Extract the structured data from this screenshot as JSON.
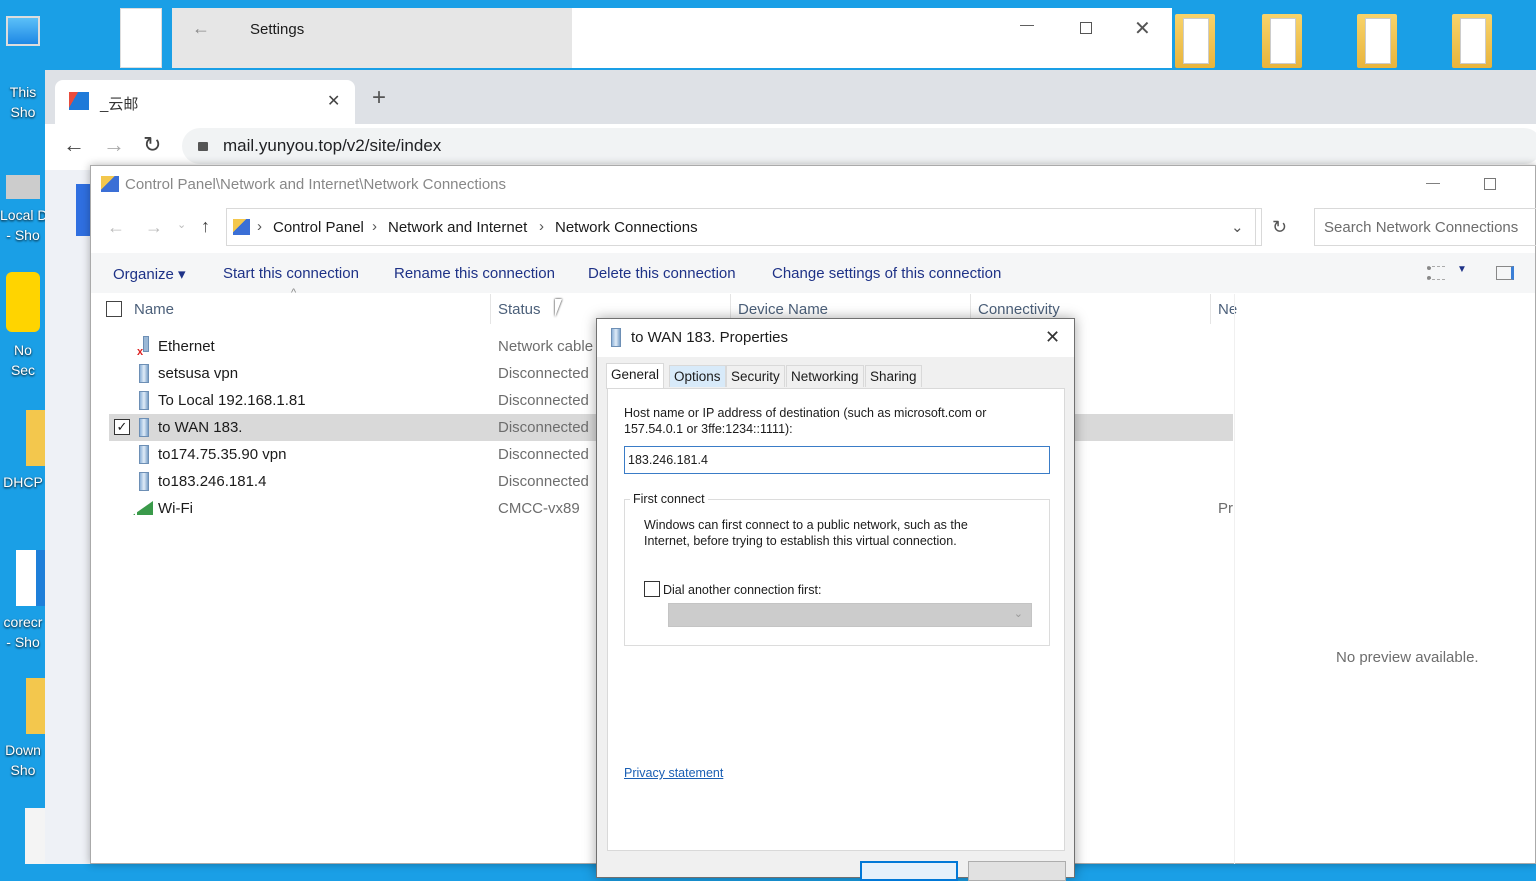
{
  "desktop": {
    "icons": [
      {
        "label": "This PC - Shortcut",
        "short1": "This",
        "short2": "Sho"
      },
      {
        "label": "Local Disk - Shortcut",
        "short1": "Local D",
        "short2": "- Sho"
      },
      {
        "label": "Norton Security",
        "short1": "No",
        "short2": "Sec"
      },
      {
        "label": "DHCP",
        "short1": "DHCP",
        "short2": ""
      },
      {
        "label": "corecr - Shortcut",
        "short1": "corecr",
        "short2": "- Sho"
      },
      {
        "label": "Downloads - Shortcut",
        "short1": "Down",
        "short2": "Sho"
      }
    ]
  },
  "settings": {
    "title": "Settings"
  },
  "chrome": {
    "tab_title": "_云邮",
    "url": "mail.yunyou.top/v2/site/index"
  },
  "explorer": {
    "title": "Control Panel\\Network and Internet\\Network Connections",
    "breadcrumb": [
      "Control Panel",
      "Network and Internet",
      "Network Connections"
    ],
    "search_placeholder": "Search Network Connections",
    "commands": [
      "Organize",
      "Start this connection",
      "Rename this connection",
      "Delete this connection",
      "Change settings of this connection"
    ],
    "columns": [
      "Name",
      "Status",
      "Device Name",
      "Connectivity",
      "Ne"
    ],
    "rows": [
      {
        "name": "Ethernet",
        "status": "Network cable unplugged",
        "icon": "ethernet-disconnected-icon"
      },
      {
        "name": "setsusa vpn",
        "status": "Disconnected",
        "icon": "vpn-icon"
      },
      {
        "name": "To Local 192.168.1.81",
        "status": "Disconnected",
        "icon": "vpn-icon"
      },
      {
        "name": "to WAN 183.",
        "status": "Disconnected",
        "icon": "vpn-icon",
        "selected": true
      },
      {
        "name": "to174.75.35.90 vpn",
        "status": "Disconnected",
        "icon": "vpn-icon"
      },
      {
        "name": "to183.246.181.4",
        "status": "Disconnected",
        "icon": "vpn-icon"
      },
      {
        "name": "Wi-Fi",
        "status": "CMCC-vx89",
        "icon": "wifi-icon",
        "extra": "Pri"
      }
    ],
    "preview_text": "No preview available."
  },
  "dialog": {
    "title": "to WAN 183. Properties",
    "tabs": [
      "General",
      "Options",
      "Security",
      "Networking",
      "Sharing"
    ],
    "host_label": "Host name or IP address of destination (such as microsoft.com or 157.54.0.1 or 3ffe:1234::1111):",
    "host_value": "183.246.181.4",
    "group_title": "First connect",
    "group_text": "Windows can first connect to a public network, such as the Internet, before trying to establish this virtual connection.",
    "dial_label": "Dial another connection first:",
    "dial_checked": false,
    "privacy_link": "Privacy statement"
  }
}
